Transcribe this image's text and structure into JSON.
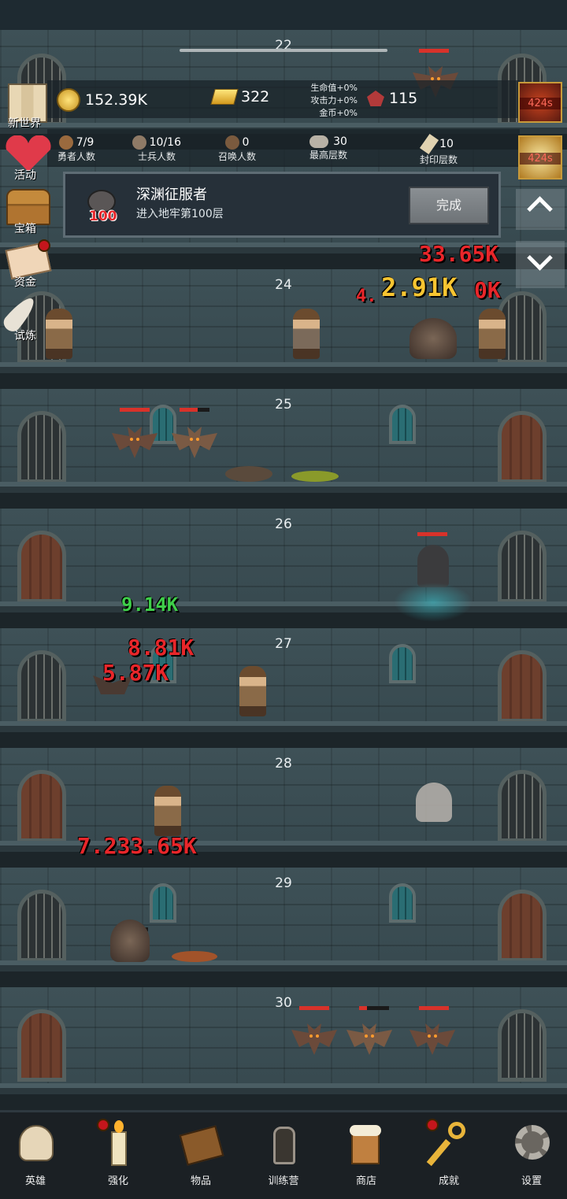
{
  "resources": {
    "coins": "152.39K",
    "gold_bars": "322",
    "gems": "115",
    "buffs": [
      "生命值+0%",
      "攻击力+0%",
      "金币+0%"
    ]
  },
  "stats": [
    {
      "value": "7/9",
      "label": "勇者人数"
    },
    {
      "value": "10/16",
      "label": "士兵人数"
    },
    {
      "value": "0",
      "label": "召唤人数"
    },
    {
      "value": "30",
      "label": "最高层数"
    },
    {
      "value": "10",
      "label": "封印层数"
    }
  ],
  "side_menu": [
    {
      "label": "新世界",
      "icon": "map-icon"
    },
    {
      "label": "活动",
      "icon": "heart-icon"
    },
    {
      "label": "宝箱",
      "icon": "chest-icon"
    },
    {
      "label": "资金",
      "icon": "envelope-icon"
    },
    {
      "label": "试炼",
      "icon": "feather-icon"
    }
  ],
  "timers": [
    "424s",
    "424s"
  ],
  "achievement": {
    "title": "深渊征服者",
    "description": "进入地牢第100层",
    "badge": "100",
    "button": "完成"
  },
  "floors": [
    "22",
    "24",
    "25",
    "26",
    "27",
    "28",
    "29",
    "30"
  ],
  "damage_numbers": {
    "f23a": "33.65K",
    "f24a": "2.91K",
    "f24b": "4.",
    "f24c": "0K",
    "heal": "9.14K",
    "f27a": "8.81K",
    "f27b": "5.87K",
    "f28a": "7.233.65K"
  },
  "nav": [
    {
      "label": "英雄",
      "icon": "skull-icon"
    },
    {
      "label": "强化",
      "icon": "candle-icon"
    },
    {
      "label": "物品",
      "icon": "book-icon"
    },
    {
      "label": "训练营",
      "icon": "lantern-icon"
    },
    {
      "label": "商店",
      "icon": "mug-icon"
    },
    {
      "label": "成就",
      "icon": "key-icon"
    },
    {
      "label": "设置",
      "icon": "gear-icon"
    }
  ],
  "colors": {
    "damage": "#e8262a",
    "heal": "#3fcf4a",
    "crit": "#f7c531",
    "hp": "#d8322a"
  }
}
